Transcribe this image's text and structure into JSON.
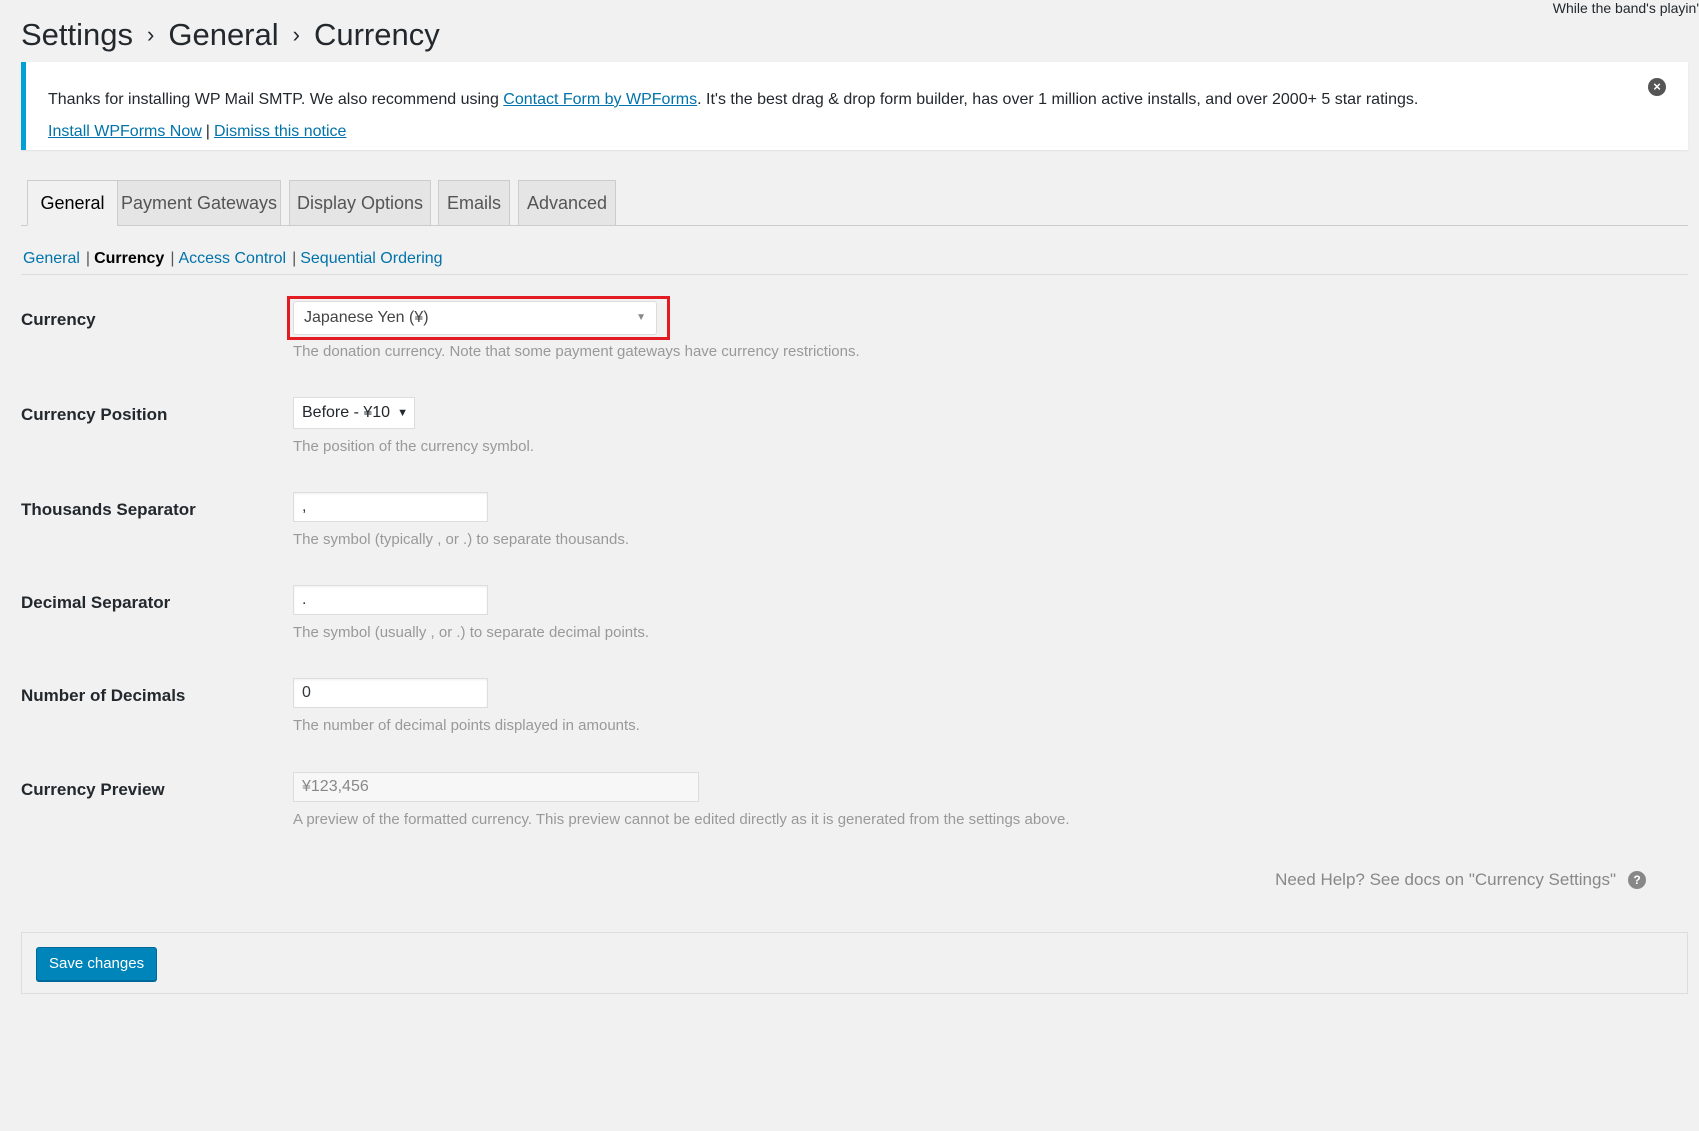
{
  "top_note": "While the band's playin'",
  "breadcrumb": [
    "Settings",
    "General",
    "Currency"
  ],
  "notice": {
    "text_before": "Thanks for installing WP Mail SMTP. We also recommend using ",
    "link1": "Contact Form by WPForms",
    "text_after": ". It's the best drag & drop form builder, has over 1 million active installs, and over 2000+ 5 star ratings.",
    "action1": "Install WPForms Now",
    "separator": "|",
    "action2": "Dismiss this notice",
    "close_icon": "×"
  },
  "tabs": [
    "General",
    "Payment Gateways",
    "Display Options",
    "Emails",
    "Advanced"
  ],
  "subnav": {
    "items": [
      "General",
      "Currency",
      "Access Control",
      "Sequential Ordering"
    ],
    "separator": "|"
  },
  "fields": {
    "currency": {
      "label": "Currency",
      "value": "Japanese Yen (¥)",
      "description": "The donation currency. Note that some payment gateways have currency restrictions."
    },
    "position": {
      "label": "Currency Position",
      "value": "Before - ¥10",
      "description": "The position of the currency symbol."
    },
    "thousands": {
      "label": "Thousands Separator",
      "value": ",",
      "description": "The symbol (typically , or .) to separate thousands."
    },
    "decimal": {
      "label": "Decimal Separator",
      "value": ".",
      "description": "The symbol (usually , or .) to separate decimal points."
    },
    "decimals": {
      "label": "Number of Decimals",
      "value": "0",
      "description": "The number of decimal points displayed in amounts."
    },
    "preview": {
      "label": "Currency Preview",
      "value": "¥123,456",
      "description": "A preview of the formatted currency. This preview cannot be edited directly as it is generated from the settings above."
    }
  },
  "help_text": "Need Help? See docs on \"Currency Settings\"",
  "help_icon": "?",
  "save_label": "Save changes",
  "colors": {
    "accent": "#0085ba",
    "link": "#0073aa",
    "highlight": "#e31b23",
    "notice_border": "#00a0d2"
  }
}
